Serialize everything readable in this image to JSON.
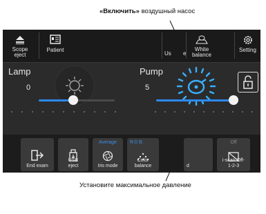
{
  "callouts": {
    "top_bold": "«Включить»",
    "top_rest": " воздушный насос",
    "bottom": "Установите максимальное давление"
  },
  "topbar": {
    "scope_eject": "Scope eject",
    "patient": "Patient",
    "user_partial": "Us",
    "user_partial_tail": "e",
    "white_balance": "White balance",
    "setting": "Setting"
  },
  "lamp": {
    "label": "Lamp",
    "value": "0",
    "level_fraction": 0.45
  },
  "pump": {
    "label": "Pump",
    "value": "5",
    "level_fraction": 1.0
  },
  "buttons": {
    "end_exam": "End exam",
    "usb_eject": "USB eject",
    "iris_tag": "Average",
    "iris_mode": "Iris mode",
    "color_tag": "R:0 B:",
    "color_balance": "Color balance",
    "partial_label": "d",
    "iscan_tag": "Off",
    "iscan": "i-scan Off-1-2-3"
  },
  "colors": {
    "accent": "#2c8af2",
    "panel": "#2b2b2b",
    "tag_blue": "#3b8fe8"
  }
}
